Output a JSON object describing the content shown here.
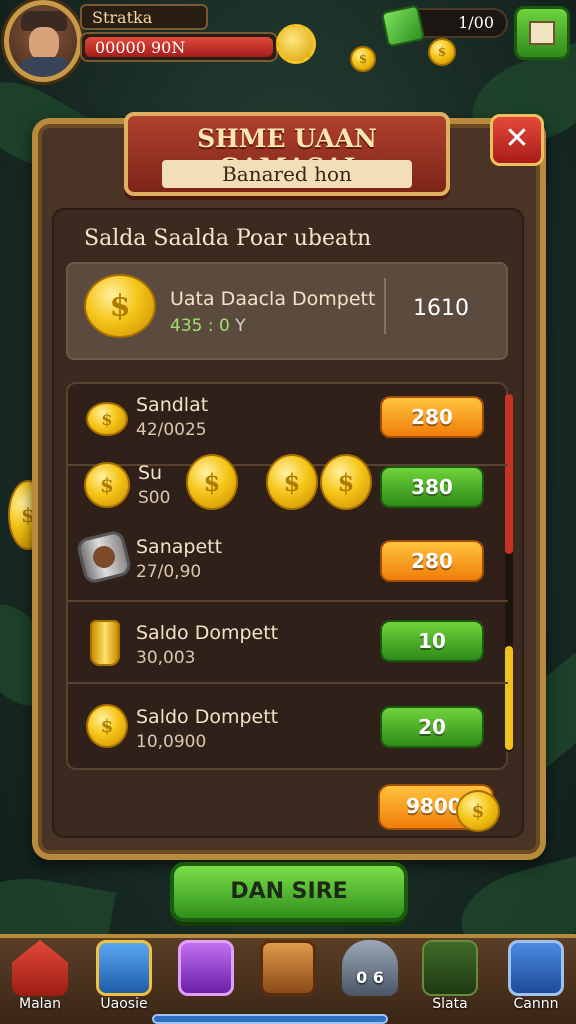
{
  "hud": {
    "player_name": "Stratka",
    "health_text": "00000 90N",
    "gem_count": "1/00"
  },
  "dialog": {
    "title": "SHME UAAN GAMASAI",
    "subtitle": "Banared hon",
    "section_title": "Salda Saalda Poar ubeatn",
    "close_label": "✕"
  },
  "wallet": {
    "name": "Uata Daacla Dompett",
    "rate": "435 : 0",
    "rate_suffix": "Y",
    "balance": "1610"
  },
  "rows": [
    {
      "name": "Sandlat",
      "amount": "42/0025",
      "button": "280",
      "button_color": "orange"
    },
    {
      "name": "Su",
      "amount": "S00",
      "button": "380",
      "button_color": "green"
    },
    {
      "name": "Sanapett",
      "amount": "27/0,90",
      "button": "280",
      "button_color": "orange"
    },
    {
      "name": "Saldo Dompett",
      "amount": "30,003",
      "button": "10",
      "button_color": "green"
    },
    {
      "name": "Saldo Dompett",
      "amount": "10,0900",
      "button": "20",
      "button_color": "green"
    }
  ],
  "total_button": "9800",
  "main_button": "DAN SIRE",
  "nav": [
    {
      "label": "Malan",
      "icon": "home-icon"
    },
    {
      "label": "Uaosie",
      "icon": "box-icon"
    },
    {
      "label": "",
      "icon": "gift-chest-icon"
    },
    {
      "label": "",
      "icon": "treasure-chest-icon"
    },
    {
      "label": "0 6",
      "icon": "lock-icon"
    },
    {
      "label": "Slata",
      "icon": "gold-bar-icon"
    },
    {
      "label": "Cannn",
      "icon": "edit-icon"
    }
  ],
  "colors": {
    "accent_gold": "#b88a3c",
    "button_orange": "#f07f0a",
    "button_green": "#2e8a18",
    "banner_red": "#7c2518"
  }
}
